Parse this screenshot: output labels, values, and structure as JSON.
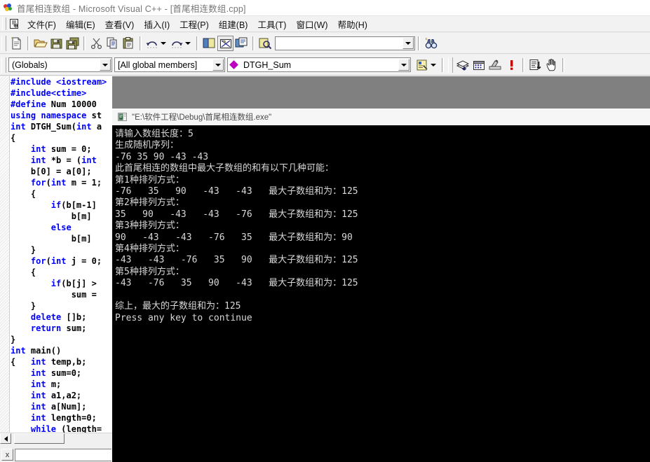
{
  "window": {
    "title": "首尾相连数组 - Microsoft Visual C++ - [首尾相连数组.cpp]",
    "app_icon": "vcpp-logo-icon"
  },
  "menu": {
    "doc_icon": "document-properties-icon",
    "items": [
      {
        "label": "文件(F)",
        "name": "menu-file"
      },
      {
        "label": "编辑(E)",
        "name": "menu-edit"
      },
      {
        "label": "查看(V)",
        "name": "menu-view"
      },
      {
        "label": "插入(I)",
        "name": "menu-insert"
      },
      {
        "label": "工程(P)",
        "name": "menu-project"
      },
      {
        "label": "组建(B)",
        "name": "menu-build"
      },
      {
        "label": "工具(T)",
        "name": "menu-tools"
      },
      {
        "label": "窗口(W)",
        "name": "menu-window"
      },
      {
        "label": "帮助(H)",
        "name": "menu-help"
      }
    ]
  },
  "toolbar": {
    "buttons": [
      {
        "name": "new-file-icon",
        "title": "新建"
      },
      {
        "name": "open-file-icon",
        "title": "打开"
      },
      {
        "name": "save-icon",
        "title": "保存"
      },
      {
        "name": "save-all-icon",
        "title": "全部保存"
      },
      {
        "name": "cut-icon",
        "title": "剪切"
      },
      {
        "name": "copy-icon",
        "title": "复制"
      },
      {
        "name": "paste-icon",
        "title": "粘贴"
      },
      {
        "name": "undo-icon",
        "title": "撤销"
      },
      {
        "name": "redo-icon",
        "title": "重做"
      },
      {
        "name": "workspace-icon",
        "title": "工作区"
      },
      {
        "name": "output-window-icon",
        "title": "输出窗口"
      },
      {
        "name": "window-list-icon",
        "title": "窗口列表"
      },
      {
        "name": "find-in-files-icon",
        "title": "在文件中查找"
      },
      {
        "name": "find-binoculars-icon",
        "title": "查找"
      }
    ],
    "find_combo_value": "",
    "find_combo_placeholder": ""
  },
  "build_toolbar": {
    "buttons": [
      {
        "name": "compile-icon",
        "title": "编译"
      },
      {
        "name": "build-icon",
        "title": "组建"
      },
      {
        "name": "rebuild-all-icon",
        "title": "全部重建"
      },
      {
        "name": "stop-build-icon",
        "title": "停止组建"
      },
      {
        "name": "execute-program-icon",
        "title": "执行"
      },
      {
        "name": "go-hand-icon",
        "title": "运行"
      }
    ]
  },
  "wizard_bar": {
    "class_combo": "(Globals)",
    "members_combo": "[All global members]",
    "function_combo": "DTGH_Sum",
    "function_icon": "member-diamond-icon",
    "action_icon": "wizardbar-actions-icon",
    "action_arrow_icon": "chevron-down-icon"
  },
  "editor": {
    "code_lines": [
      [
        {
          "t": "#include ",
          "c": "pp"
        },
        {
          "t": "<iostream>",
          "c": "pp"
        }
      ],
      [
        {
          "t": "#include<ctime>",
          "c": "pp"
        }
      ],
      [
        {
          "t": "#define ",
          "c": "pp"
        },
        {
          "t": "Num 10000",
          "c": ""
        }
      ],
      [
        {
          "t": "using namespace ",
          "c": "kw"
        },
        {
          "t": "st",
          "c": ""
        }
      ],
      [
        {
          "t": "int ",
          "c": "kw"
        },
        {
          "t": "DTGH_Sum(",
          "c": ""
        },
        {
          "t": "int ",
          "c": "kw"
        },
        {
          "t": "a",
          "c": ""
        }
      ],
      [
        {
          "t": "{",
          "c": ""
        }
      ],
      [
        {
          "t": "    ",
          "c": ""
        },
        {
          "t": "int ",
          "c": "kw"
        },
        {
          "t": "sum = 0;",
          "c": ""
        }
      ],
      [
        {
          "t": "    ",
          "c": ""
        },
        {
          "t": "int ",
          "c": "kw"
        },
        {
          "t": "*b = (",
          "c": ""
        },
        {
          "t": "int",
          "c": "kw"
        }
      ],
      [
        {
          "t": "    b[0] = a[0];",
          "c": ""
        }
      ],
      [
        {
          "t": "    ",
          "c": ""
        },
        {
          "t": "for",
          "c": "kw"
        },
        {
          "t": "(",
          "c": ""
        },
        {
          "t": "int ",
          "c": "kw"
        },
        {
          "t": "m = 1;",
          "c": ""
        }
      ],
      [
        {
          "t": "    {",
          "c": ""
        }
      ],
      [
        {
          "t": "        ",
          "c": ""
        },
        {
          "t": "if",
          "c": "kw"
        },
        {
          "t": "(b[m-1]",
          "c": ""
        }
      ],
      [
        {
          "t": "            b[m] ",
          "c": ""
        }
      ],
      [
        {
          "t": "        ",
          "c": ""
        },
        {
          "t": "else",
          "c": "kw"
        }
      ],
      [
        {
          "t": "            b[m] ",
          "c": ""
        }
      ],
      [
        {
          "t": "    }",
          "c": ""
        }
      ],
      [
        {
          "t": "    ",
          "c": ""
        },
        {
          "t": "for",
          "c": "kw"
        },
        {
          "t": "(",
          "c": ""
        },
        {
          "t": "int ",
          "c": "kw"
        },
        {
          "t": "j = 0;",
          "c": ""
        }
      ],
      [
        {
          "t": "    {",
          "c": ""
        }
      ],
      [
        {
          "t": "        ",
          "c": ""
        },
        {
          "t": "if",
          "c": "kw"
        },
        {
          "t": "(b[j] >",
          "c": ""
        }
      ],
      [
        {
          "t": "            sum =",
          "c": ""
        }
      ],
      [
        {
          "t": "    }",
          "c": ""
        }
      ],
      [
        {
          "t": "    ",
          "c": ""
        },
        {
          "t": "delete ",
          "c": "kw"
        },
        {
          "t": "[]b;",
          "c": ""
        }
      ],
      [
        {
          "t": "    ",
          "c": ""
        },
        {
          "t": "return ",
          "c": "kw"
        },
        {
          "t": "sum;",
          "c": ""
        }
      ],
      [
        {
          "t": "}",
          "c": ""
        }
      ],
      [
        {
          "t": "int ",
          "c": "kw"
        },
        {
          "t": "main()",
          "c": ""
        }
      ],
      [
        {
          "t": "{   ",
          "c": ""
        },
        {
          "t": "int ",
          "c": "kw"
        },
        {
          "t": "temp,b;",
          "c": ""
        }
      ],
      [
        {
          "t": "    ",
          "c": ""
        },
        {
          "t": "int ",
          "c": "kw"
        },
        {
          "t": "sum=0;",
          "c": ""
        }
      ],
      [
        {
          "t": "    ",
          "c": ""
        },
        {
          "t": "int ",
          "c": "kw"
        },
        {
          "t": "m;",
          "c": ""
        }
      ],
      [
        {
          "t": "    ",
          "c": ""
        },
        {
          "t": "int ",
          "c": "kw"
        },
        {
          "t": "a1,a2;",
          "c": ""
        }
      ],
      [
        {
          "t": "    ",
          "c": ""
        },
        {
          "t": "int ",
          "c": "kw"
        },
        {
          "t": "a[Num];",
          "c": ""
        }
      ],
      [
        {
          "t": "    ",
          "c": ""
        },
        {
          "t": "int ",
          "c": "kw"
        },
        {
          "t": "length=0;",
          "c": ""
        }
      ],
      [
        {
          "t": "    ",
          "c": ""
        },
        {
          "t": "while ",
          "c": "kw"
        },
        {
          "t": "(length=",
          "c": ""
        }
      ]
    ],
    "hscroll_left_icon": "scroll-left-arrow-icon"
  },
  "output_pane": {
    "close_label": "x",
    "field_value": ""
  },
  "console": {
    "icon": "console-window-icon",
    "title": "\"E:\\软件工程\\Debug\\首尾相连数组.exe\"",
    "output": "请输入数组长度：5\n生成随机序列：\n-76 35 90 -43 -43\n此首尾相连的数组中最大子数组的和有以下几种可能：\n第1种排列方式：\n-76   35   90   -43   -43   最大子数组和为：125\n第2种排列方式：\n35   90   -43   -43   -76   最大子数组和为：125\n第3种排列方式：\n90   -43   -43   -76   35   最大子数组和为：90\n第4种排列方式：\n-43   -43   -76   35   90   最大子数组和为：125\n第5种排列方式：\n-43   -76   35   90   -43   最大子数组和为：125\n\n综上，最大的子数组和为：125\nPress any key to continue"
  }
}
